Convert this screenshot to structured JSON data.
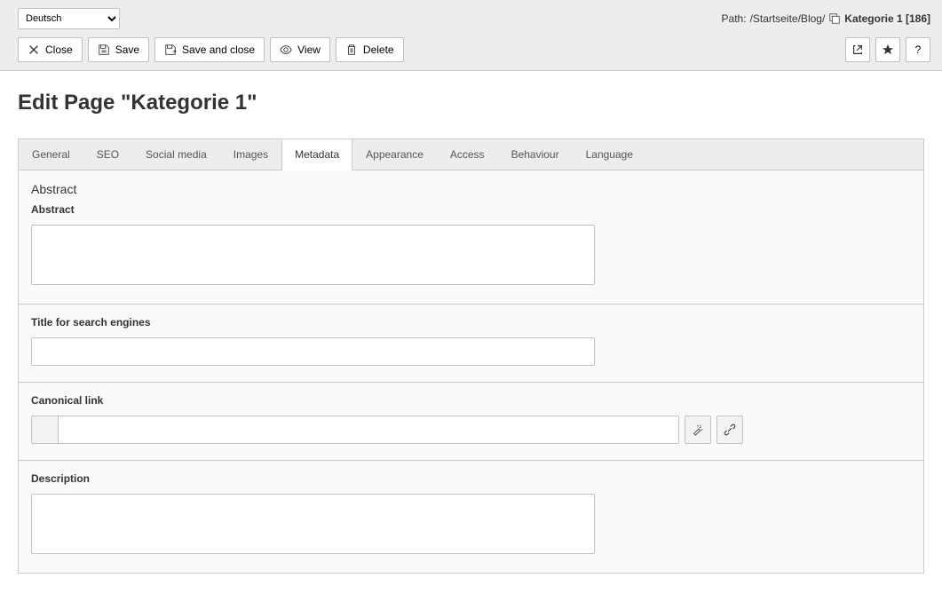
{
  "language_selector": {
    "value": "Deutsch"
  },
  "path": {
    "prefix": "Path: ",
    "segments": "/Startseite/Blog/",
    "current": "Kategorie 1 [186]"
  },
  "toolbar": {
    "close": "Close",
    "save": "Save",
    "save_close": "Save and close",
    "view": "View",
    "delete": "Delete",
    "help": "?"
  },
  "title": "Edit Page \"Kategorie 1\"",
  "tabs": [
    {
      "label": "General"
    },
    {
      "label": "SEO"
    },
    {
      "label": "Social media"
    },
    {
      "label": "Images"
    },
    {
      "label": "Metadata"
    },
    {
      "label": "Appearance"
    },
    {
      "label": "Access"
    },
    {
      "label": "Behaviour"
    },
    {
      "label": "Language"
    }
  ],
  "active_tab_index": 4,
  "form": {
    "abstract_heading": "Abstract",
    "abstract_label": "Abstract",
    "abstract_value": "",
    "title_se_label": "Title for search engines",
    "title_se_value": "",
    "canonical_label": "Canonical link",
    "canonical_value": "",
    "description_label": "Description",
    "description_value": ""
  }
}
